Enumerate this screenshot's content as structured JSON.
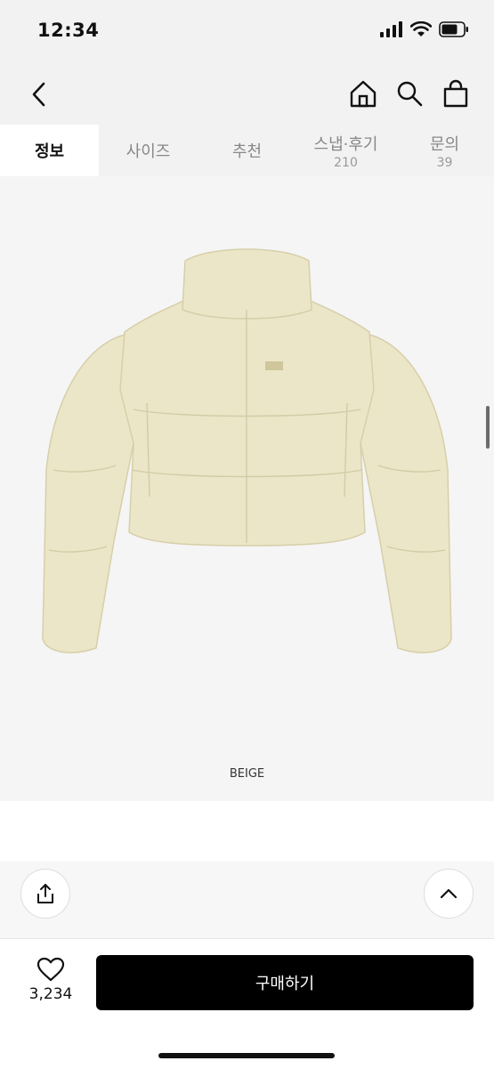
{
  "status_bar": {
    "time": "12:34"
  },
  "nav": {
    "back_icon": "chevron-left-icon",
    "icons": [
      "home-icon",
      "search-icon",
      "shopping-bag-icon"
    ]
  },
  "tabs": [
    {
      "label": "정보",
      "count": ""
    },
    {
      "label": "사이즈",
      "count": ""
    },
    {
      "label": "추천",
      "count": ""
    },
    {
      "label": "스냅·후기",
      "count": "210"
    },
    {
      "label": "문의",
      "count": "39"
    }
  ],
  "product": {
    "color_label": "BEIGE",
    "jacket_color": "#ece6c8"
  },
  "actions": {
    "share_icon": "share-icon",
    "top_icon": "chevron-up-icon"
  },
  "bottom_bar": {
    "like_icon": "heart-icon",
    "like_count": "3,234",
    "buy_label": "구매하기"
  }
}
